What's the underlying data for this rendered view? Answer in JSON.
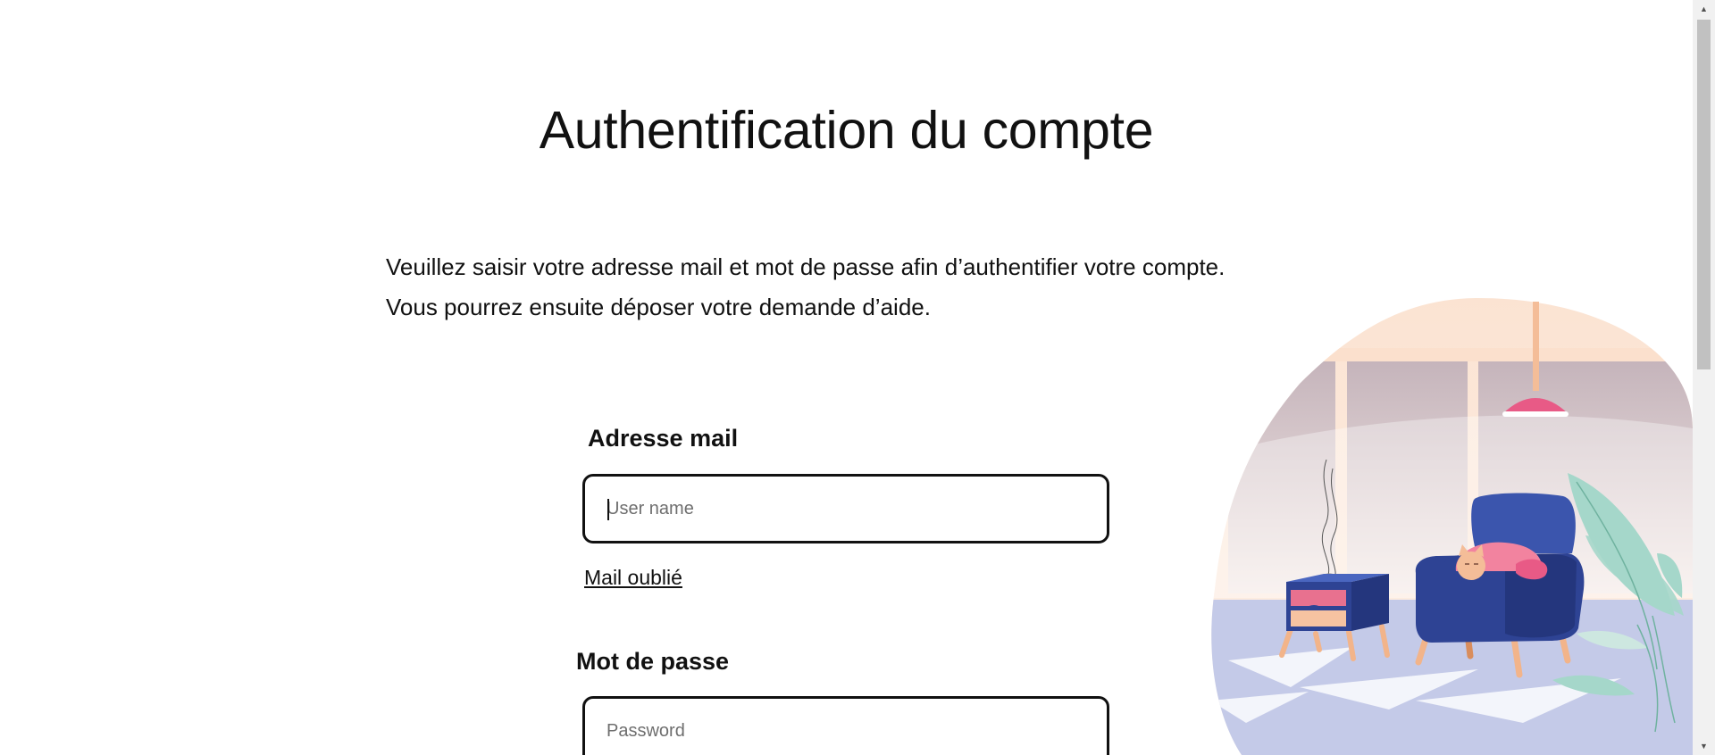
{
  "header": {
    "title": "Authentification du compte"
  },
  "intro": {
    "line1": "Veuillez saisir votre adresse mail et mot de passe afin d’authentifier votre compte.",
    "line2": "Vous pourrez ensuite déposer votre demande d’aide."
  },
  "form": {
    "email_label": "Adresse mail",
    "email_placeholder": "User name",
    "email_value": "",
    "forgot_mail_link": "Mail oublié",
    "password_label": "Mot de passe",
    "password_placeholder": "Password",
    "password_value": ""
  },
  "illustration": {
    "icon": "living-room-illustration",
    "colors": {
      "blob_peach": "#fbe6d6",
      "floor": "#c4cae8",
      "chair": "#2e4394",
      "lamp": "#e85a86",
      "cat": "#f2839f",
      "plant": "#a5d7ca"
    }
  },
  "scrollbar": {
    "up_icon": "triangle-up-icon",
    "down_icon": "triangle-down-icon"
  }
}
